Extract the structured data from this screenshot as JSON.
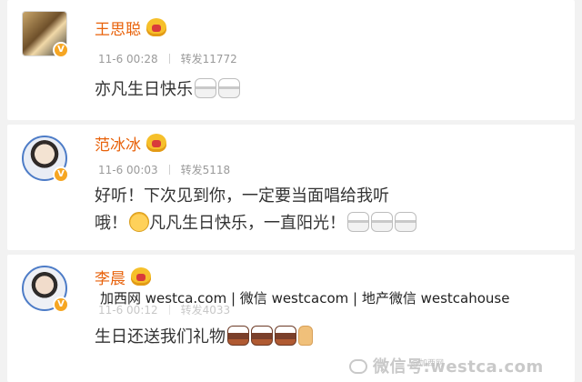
{
  "posts": [
    {
      "username": "王思聪",
      "time": "11-6 00:28",
      "repost": "转发11772",
      "text": "亦凡生日快乐",
      "emojis": [
        "cake-icon",
        "cake-icon"
      ]
    },
    {
      "username": "范冰冰",
      "time": "11-6 00:03",
      "repost": "转发5118",
      "text_line1": "好听！下次见到你，一定要当面唱给我听",
      "text_line2a": "哦！",
      "text_line2b": "凡凡生日快乐，一直阳光！",
      "emojis": [
        "smile-icon",
        "cake-icon",
        "cake-icon",
        "cake-icon"
      ]
    },
    {
      "username": "李晨",
      "time": "11-6 00:12",
      "repost": "转发4033",
      "text": "生日还送我们礼物",
      "emojis": [
        "cake-icon",
        "cake-icon",
        "cake-icon",
        "thumbs-up-icon"
      ]
    }
  ],
  "overlay": {
    "caption": "加西网 westca.com | 微信 westcacom | 地产微信 westcahouse"
  },
  "watermark": {
    "main": "微信号:westca.com",
    "small": "@加西网"
  },
  "colors": {
    "name": "#e8620b",
    "meta": "#9a9a9a",
    "verified": "#f6a623"
  }
}
